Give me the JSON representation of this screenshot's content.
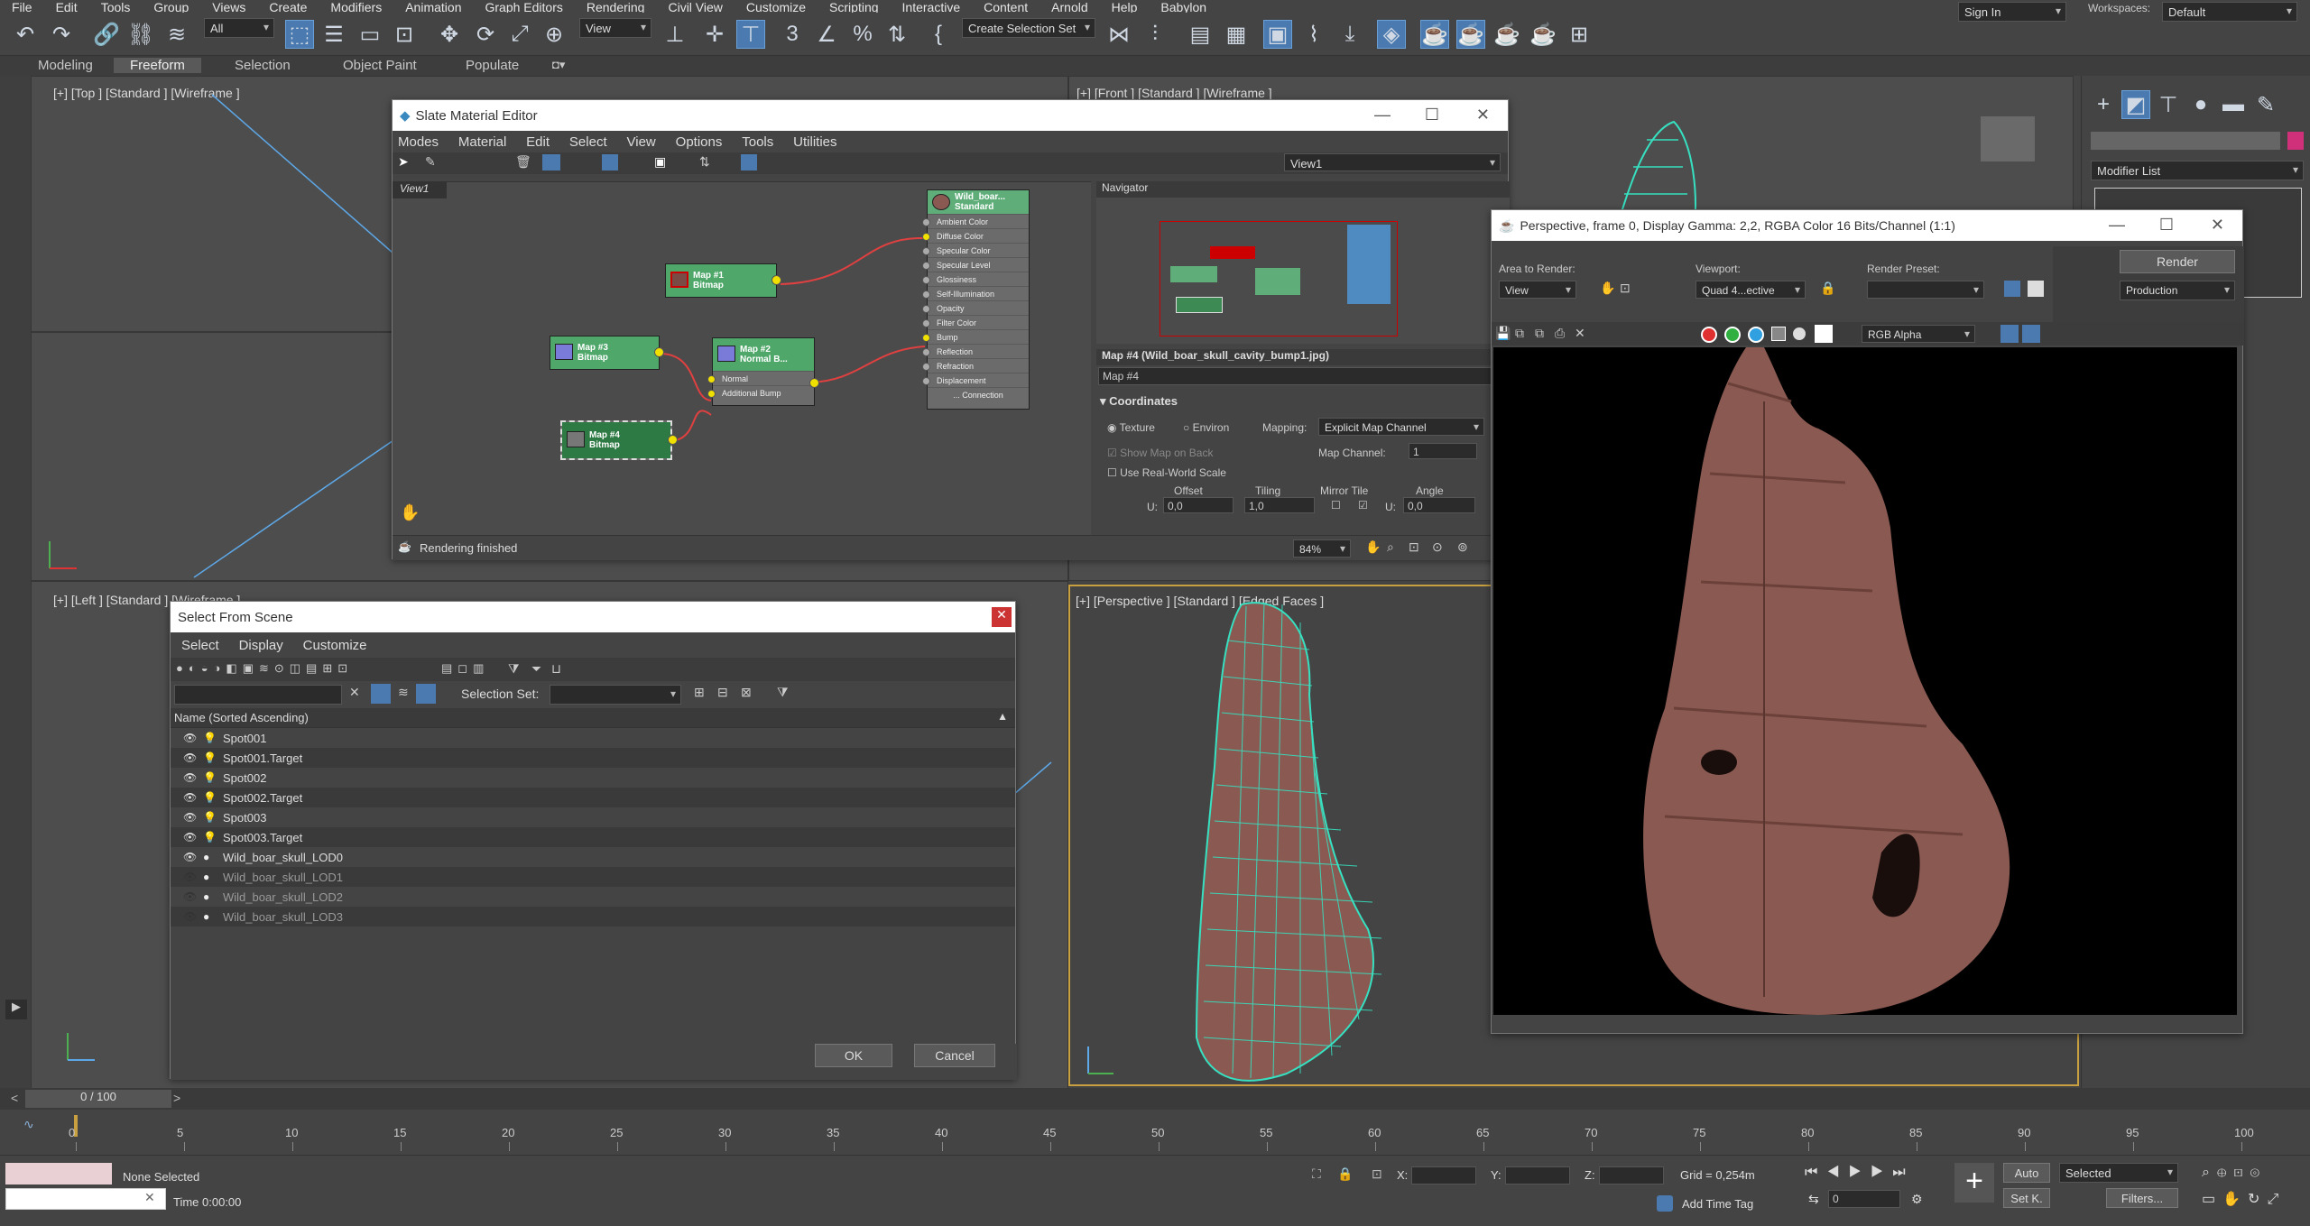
{
  "menubar": [
    "File",
    "Edit",
    "Tools",
    "Group",
    "Views",
    "Create",
    "Modifiers",
    "Animation",
    "Graph Editors",
    "Rendering",
    "Civil View",
    "Customize",
    "Scripting",
    "Interactive",
    "Content",
    "Arnold",
    "Help",
    "Babylon"
  ],
  "toolbar": {
    "filter_value": "All",
    "view_value": "View",
    "selection_set_value": "Create Selection Set",
    "sign_in": "Sign In",
    "workspaces_label": "Workspaces:",
    "workspace_value": "Default"
  },
  "ribbon": {
    "tabs": [
      "Modeling",
      "Freeform",
      "Selection",
      "Object Paint",
      "Populate"
    ],
    "active": "Freeform"
  },
  "viewports": {
    "top": "[+] [Top ] [Standard ] [Wireframe ]",
    "front": "[+] [Front ] [Standard ] [Wireframe ]",
    "left": "[+] [Left ] [Standard ] [Wireframe ]",
    "perspective": "[+] [Perspective ] [Standard ] [Edged Faces ]"
  },
  "slate": {
    "title": "Slate Material Editor",
    "menu": [
      "Modes",
      "Material",
      "Edit",
      "Select",
      "View",
      "Options",
      "Tools",
      "Utilities"
    ],
    "view_tab": "View1",
    "view_dropdown": "View1",
    "navigator_title": "Navigator",
    "nodes": {
      "mat_name": "Wild_boar...",
      "mat_type": "Standard",
      "slots": [
        "Ambient Color",
        "Diffuse Color",
        "Specular Color",
        "Specular Level",
        "Glossiness",
        "Self-Illumination",
        "Opacity",
        "Filter Color",
        "Bump",
        "Reflection",
        "Refraction",
        "Displacement"
      ],
      "more": "... Connection",
      "map1_name": "Map #1",
      "map1_type": "Bitmap",
      "map3_name": "Map #3",
      "map3_type": "Bitmap",
      "map2_name": "Map #2",
      "map2_type": "Normal B...",
      "map2_slots": [
        "Normal",
        "Additional Bump"
      ],
      "map4_name": "Map #4",
      "map4_type": "Bitmap"
    },
    "params": {
      "header": "Map #4 (Wild_boar_skull_cavity_bump1.jpg)",
      "name": "Map #4",
      "rollout": "Coordinates",
      "texture": "Texture",
      "environ": "Environ",
      "mapping_label": "Mapping:",
      "mapping_value": "Explicit Map Channel",
      "show_map": "Show Map on Back",
      "map_channel_label": "Map Channel:",
      "map_channel": "1",
      "real_world": "Use Real-World Scale",
      "offset": "Offset",
      "tiling": "Tiling",
      "mirror_tile": "Mirror Tile",
      "angle": "Angle",
      "u_label": "U:",
      "offset_u": "0,0",
      "tiling_u": "1,0",
      "angle_u": "0,0"
    },
    "status": "Rendering finished",
    "zoom": "84%"
  },
  "render": {
    "title": "Perspective, frame 0, Display Gamma: 2,2, RGBA Color 16 Bits/Channel (1:1)",
    "area_label": "Area to Render:",
    "area_value": "View",
    "viewport_label": "Viewport:",
    "viewport_value": "Quad 4...ective",
    "preset_label": "Render Preset:",
    "preset_value": "",
    "render_btn": "Render",
    "production": "Production",
    "channel": "RGB Alpha"
  },
  "scene": {
    "title": "Select From Scene",
    "menu": [
      "Select",
      "Display",
      "Customize"
    ],
    "selection_set_label": "Selection Set:",
    "column": "Name (Sorted Ascending)",
    "items": [
      {
        "name": "Spot001",
        "kind": "light",
        "visible": true
      },
      {
        "name": "Spot001.Target",
        "kind": "light",
        "visible": true
      },
      {
        "name": "Spot002",
        "kind": "light",
        "visible": true
      },
      {
        "name": "Spot002.Target",
        "kind": "light",
        "visible": true
      },
      {
        "name": "Spot003",
        "kind": "light",
        "visible": true
      },
      {
        "name": "Spot003.Target",
        "kind": "light",
        "visible": true
      },
      {
        "name": "Wild_boar_skull_LOD0",
        "kind": "geo",
        "visible": true
      },
      {
        "name": "Wild_boar_skull_LOD1",
        "kind": "geo",
        "visible": false
      },
      {
        "name": "Wild_boar_skull_LOD2",
        "kind": "geo",
        "visible": false
      },
      {
        "name": "Wild_boar_skull_LOD3",
        "kind": "geo",
        "visible": false
      }
    ],
    "ok": "OK",
    "cancel": "Cancel"
  },
  "cmdpanel": {
    "modifier_list": "Modifier List"
  },
  "timeline": {
    "frame": "0 / 100",
    "ticks": [
      "0",
      "5",
      "10",
      "15",
      "20",
      "25",
      "30",
      "35",
      "40",
      "45",
      "50",
      "55",
      "60",
      "65",
      "70",
      "75",
      "80",
      "85",
      "90",
      "95",
      "100"
    ]
  },
  "status": {
    "none_selected": "None Selected",
    "add_time_tag": "Add Time Tag",
    "time": "Time  0:00:00",
    "x_label": "X:",
    "y_label": "Y:",
    "z_label": "Z:",
    "grid": "Grid = 0,254m",
    "auto": "Auto",
    "selected": "Selected",
    "setk": "Set K.",
    "filters": "Filters...",
    "frame_field": "0"
  },
  "colors": {
    "accent": "#4a7ab0",
    "mat_node": "#5fae7a",
    "map_node": "#4fa86a",
    "wire": "#36e0c0",
    "skull": "#8a5a52"
  }
}
